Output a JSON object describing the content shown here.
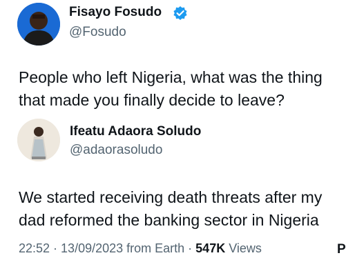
{
  "tweet": {
    "author": {
      "name": "Fisayo Fosudo",
      "handle": "@Fosudo",
      "verified": true
    },
    "text_lines": [
      "People who left Nigeria, what was the thing",
      "that made you finally decide to leave?"
    ]
  },
  "quoted": {
    "author": {
      "name": "Ifeatu Adaora Soludo",
      "handle": "@adaorasoludo"
    },
    "text_lines": [
      "We started receiving death threats after my",
      "dad reformed the banking sector in Nigeria"
    ]
  },
  "meta": {
    "time": "22:52",
    "separator1": " · ",
    "date": "13/09/2023",
    "source": " from Earth",
    "separator2": " · ",
    "views_count": "547K",
    "views_label": " Views"
  },
  "cut_off_text": "P",
  "colors": {
    "verified_badge": "#1d9bf0",
    "secondary_text": "#536471",
    "primary_text": "#0f1419"
  },
  "icons": {
    "verified": "verified-badge-icon"
  }
}
